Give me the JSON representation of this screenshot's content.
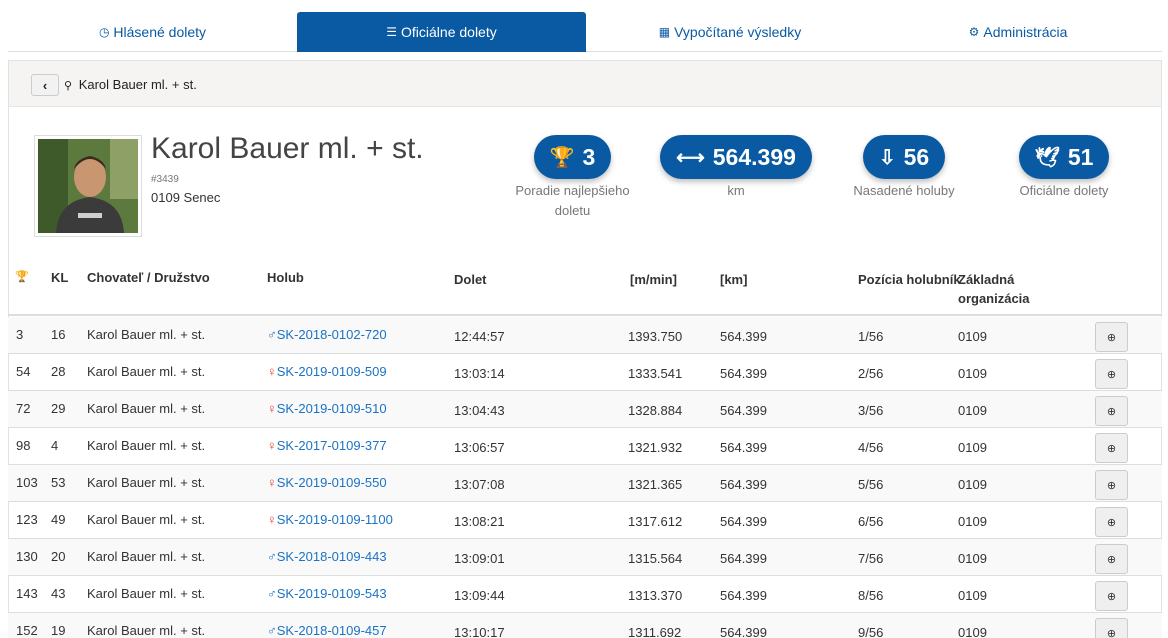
{
  "tabs": [
    {
      "label": "Hlásené dolety",
      "icon": "clock-icon",
      "glyph": "◷",
      "active": false
    },
    {
      "label": "Oficiálne dolety",
      "icon": "database-icon",
      "glyph": "☰",
      "active": true
    },
    {
      "label": "Vypočítané výsledky",
      "icon": "table-icon",
      "glyph": "▦",
      "active": false
    },
    {
      "label": "Administrácia",
      "icon": "cogs-icon",
      "glyph": "⚙",
      "active": false
    }
  ],
  "breadcrumb": {
    "back_glyph": "‹",
    "search_glyph": "⚲",
    "text": "Karol Bauer ml. + st."
  },
  "profile": {
    "name": "Karol Bauer ml. + st.",
    "reg_no": "#3439",
    "club": "0109 Senec"
  },
  "stats": [
    {
      "value": "3",
      "label": "Poradie najlepšieho doletu",
      "icon": "trophy-icon",
      "glyph": "🏆"
    },
    {
      "value": "564.399",
      "label": "km",
      "icon": "arrows-horizontal-icon",
      "glyph": "⟷"
    },
    {
      "value": "56",
      "label": "Nasadené holuby",
      "icon": "inbox-in-icon",
      "glyph": "⇩"
    },
    {
      "value": "51",
      "label": "Oficiálne dolety",
      "icon": "dove-clock-icon",
      "glyph": "🕊"
    }
  ],
  "table": {
    "headers": {
      "rank_icon": "trophy-icon",
      "rank_glyph": "🏆",
      "kl": "KL",
      "breeder": "Chovateľ / Družstvo",
      "pigeon": "Holub",
      "time": "Dolet",
      "speed": "[m/min]",
      "km": "[km]",
      "pos": "Pozícia holubník",
      "org_line1": "Základná",
      "org_line2": "organizácia"
    },
    "rows": [
      {
        "rank": "3",
        "kl": "16",
        "breeder": "Karol Bauer ml. + st.",
        "sex": "♂",
        "ring": "SK-2018-0102-720",
        "time": "12:44:57",
        "speed": "1393.750",
        "km": "564.399",
        "pos": "1/56",
        "org": "0109"
      },
      {
        "rank": "54",
        "kl": "28",
        "breeder": "Karol Bauer ml. + st.",
        "sex": "♀",
        "ring": "SK-2019-0109-509",
        "time": "13:03:14",
        "speed": "1333.541",
        "km": "564.399",
        "pos": "2/56",
        "org": "0109"
      },
      {
        "rank": "72",
        "kl": "29",
        "breeder": "Karol Bauer ml. + st.",
        "sex": "♀",
        "ring": "SK-2019-0109-510",
        "time": "13:04:43",
        "speed": "1328.884",
        "km": "564.399",
        "pos": "3/56",
        "org": "0109"
      },
      {
        "rank": "98",
        "kl": "4",
        "breeder": "Karol Bauer ml. + st.",
        "sex": "♀",
        "ring": "SK-2017-0109-377",
        "time": "13:06:57",
        "speed": "1321.932",
        "km": "564.399",
        "pos": "4/56",
        "org": "0109"
      },
      {
        "rank": "103",
        "kl": "53",
        "breeder": "Karol Bauer ml. + st.",
        "sex": "♀",
        "ring": "SK-2019-0109-550",
        "time": "13:07:08",
        "speed": "1321.365",
        "km": "564.399",
        "pos": "5/56",
        "org": "0109"
      },
      {
        "rank": "123",
        "kl": "49",
        "breeder": "Karol Bauer ml. + st.",
        "sex": "♀",
        "ring": "SK-2019-0109-1100",
        "time": "13:08:21",
        "speed": "1317.612",
        "km": "564.399",
        "pos": "6/56",
        "org": "0109"
      },
      {
        "rank": "130",
        "kl": "20",
        "breeder": "Karol Bauer ml. + st.",
        "sex": "♂",
        "ring": "SK-2018-0109-443",
        "time": "13:09:01",
        "speed": "1315.564",
        "km": "564.399",
        "pos": "7/56",
        "org": "0109"
      },
      {
        "rank": "143",
        "kl": "43",
        "breeder": "Karol Bauer ml. + st.",
        "sex": "♂",
        "ring": "SK-2019-0109-543",
        "time": "13:09:44",
        "speed": "1313.370",
        "km": "564.399",
        "pos": "8/56",
        "org": "0109"
      },
      {
        "rank": "152",
        "kl": "19",
        "breeder": "Karol Bauer ml. + st.",
        "sex": "♂",
        "ring": "SK-2018-0109-457",
        "time": "13:10:17",
        "speed": "1311.692",
        "km": "564.399",
        "pos": "9/56",
        "org": "0109"
      }
    ],
    "detail_icon": "zoom-in-icon",
    "detail_glyph": "⊕"
  },
  "colors": {
    "primary": "#0a5aa3",
    "link": "#1a73c4",
    "female": "#e0413a"
  }
}
